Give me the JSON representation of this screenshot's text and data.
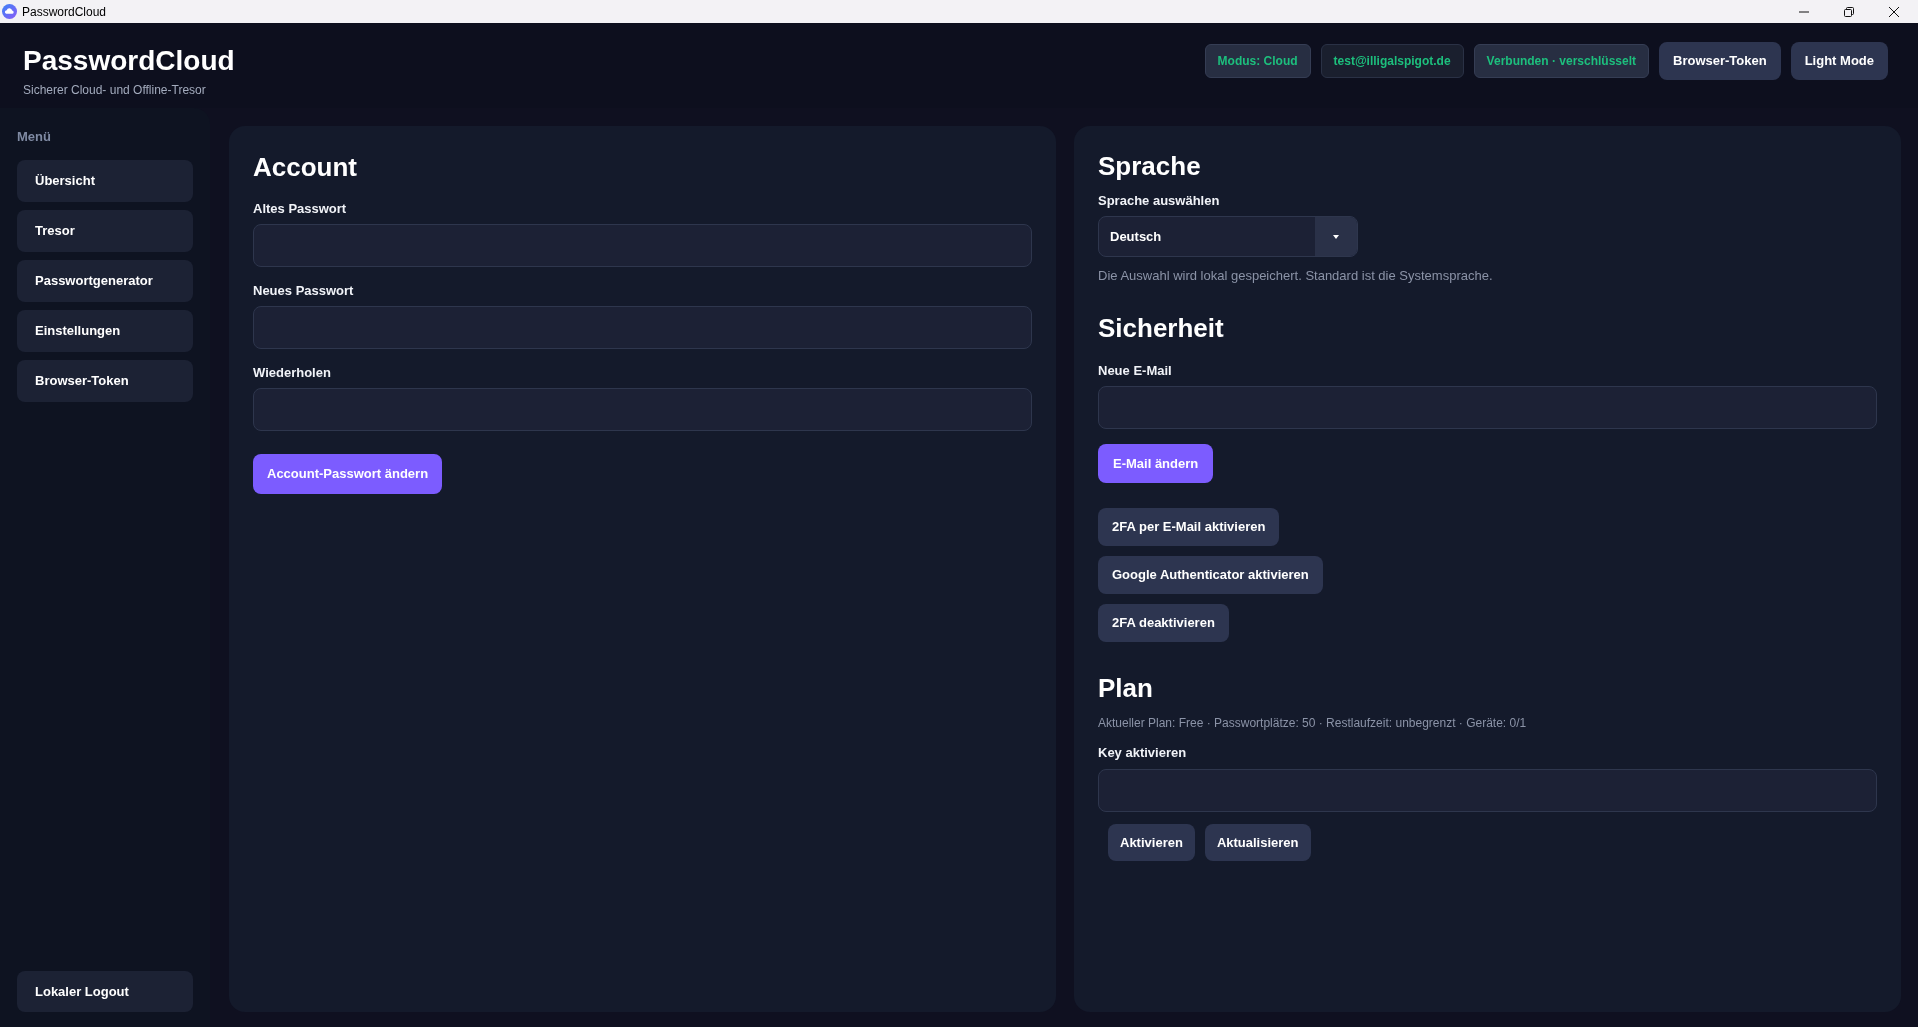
{
  "window": {
    "title": "PasswordCloud"
  },
  "header": {
    "app_name": "PasswordCloud",
    "tagline": "Sicherer Cloud- und Offline-Tresor",
    "badges": [
      {
        "label": "Modus: Cloud",
        "kind": "status"
      },
      {
        "label": "test@illigalspigot.de",
        "kind": "account"
      },
      {
        "label": "Verbunden · verschlüsselt",
        "kind": "status"
      }
    ],
    "buttons": [
      "Browser-Token",
      "Light Mode"
    ]
  },
  "sidebar": {
    "heading": "Menü",
    "items": [
      "Übersicht",
      "Tresor",
      "Passwortgenerator",
      "Einstellungen",
      "Browser-Token"
    ],
    "footer_button": "Lokaler Logout"
  },
  "account": {
    "title": "Account",
    "fields": [
      {
        "label": "Altes Passwort"
      },
      {
        "label": "Neues Passwort"
      },
      {
        "label": "Wiederholen"
      }
    ],
    "submit": "Account-Passwort ändern"
  },
  "language": {
    "title": "Sprache",
    "label": "Sprache auswählen",
    "value": "Deutsch",
    "hint": "Die Auswahl wird lokal gespeichert. Standard ist die Systemsprache."
  },
  "security": {
    "title": "Sicherheit",
    "email_label": "Neue E-Mail",
    "email_button": "E-Mail ändern",
    "twofa_buttons": [
      "2FA per E-Mail aktivieren",
      "Google Authenticator aktivieren",
      "2FA deaktivieren"
    ]
  },
  "plan": {
    "title": "Plan",
    "info": "Aktueller Plan: Free · Passwortplätze: 50 · Restlaufzeit: unbegrenzt · Geräte: 0/1",
    "key_label": "Key aktivieren",
    "buttons": [
      "Aktivieren",
      "Aktualisieren"
    ]
  }
}
